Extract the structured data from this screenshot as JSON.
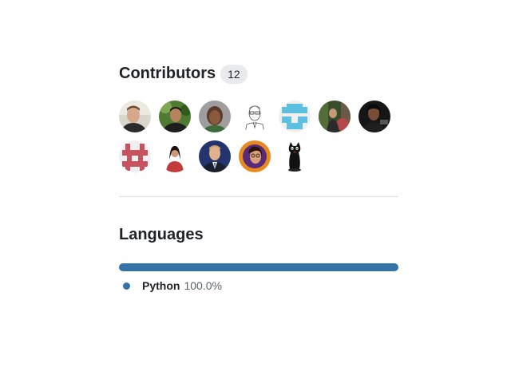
{
  "contributors": {
    "title": "Contributors",
    "count": "12",
    "avatars": [
      {
        "icon": "avatar-icon",
        "desc": "man in dark shirt"
      },
      {
        "icon": "avatar-icon",
        "desc": "man outdoors green background"
      },
      {
        "icon": "avatar-icon",
        "desc": "woman with short hair"
      },
      {
        "icon": "avatar-icon",
        "desc": "sketch of man with glasses"
      },
      {
        "icon": "identicon",
        "desc": "light blue identicon"
      },
      {
        "icon": "avatar-icon",
        "desc": "person in forest"
      },
      {
        "icon": "avatar-icon",
        "desc": "woman dark background"
      },
      {
        "icon": "identicon",
        "desc": "red identicon"
      },
      {
        "icon": "avatar-icon",
        "desc": "woman in red top"
      },
      {
        "icon": "avatar-icon",
        "desc": "man in suit blue background"
      },
      {
        "icon": "avatar-icon",
        "desc": "cartoon face purple"
      },
      {
        "icon": "avatar-icon",
        "desc": "black cat figure"
      }
    ]
  },
  "languages": {
    "title": "Languages",
    "items": [
      {
        "name": "Python",
        "percent_label": "100.0%",
        "fraction": 1.0,
        "color": "#3572a5"
      }
    ]
  }
}
